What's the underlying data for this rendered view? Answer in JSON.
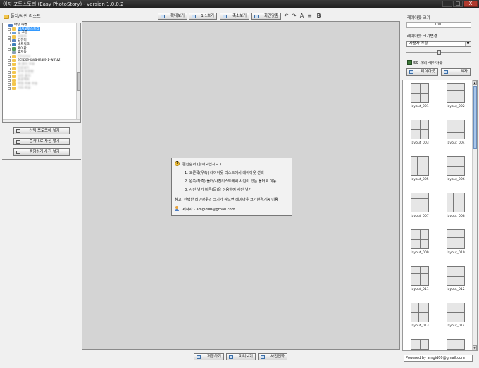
{
  "window": {
    "title": "이지 포토스토리 (Easy PhotoStory) - version 1.0.0.2",
    "buttons": [
      "_",
      "□",
      "X"
    ]
  },
  "left_panel": {
    "header": "폴더/사진 리스트",
    "tree": [
      {
        "label": "바탕 화면",
        "indent": 0,
        "icon": "desktop-icon",
        "expander": false
      },
      {
        "label": "이지포토스토리",
        "indent": 1,
        "icon": "folder-icon",
        "expander": true,
        "selected": true
      },
      {
        "label": "공 그룹",
        "indent": 1,
        "icon": "user-group-icon",
        "expander": true
      },
      {
        "label": "사용자",
        "indent": 1,
        "icon": "user-folder-icon",
        "expander": true,
        "blurred": true
      },
      {
        "label": "컴퓨터",
        "indent": 1,
        "icon": "computer-icon",
        "expander": true
      },
      {
        "label": "네트워크",
        "indent": 1,
        "icon": "network-icon",
        "expander": true
      },
      {
        "label": "제어판",
        "indent": 1,
        "icon": "control-panel-icon",
        "expander": true
      },
      {
        "label": "휴지통",
        "indent": 1,
        "icon": "recycle-bin-icon",
        "expander": false
      },
      {
        "label": "Chrome",
        "indent": 1,
        "icon": "folder-icon",
        "expander": true,
        "blurred": true
      },
      {
        "label": "eclipse-java-mars-1-win32",
        "indent": 1,
        "icon": "folder-icon",
        "expander": true
      },
      {
        "label": "새 폴더 모음",
        "indent": 1,
        "icon": "folder-icon",
        "expander": true,
        "blurred": true
      },
      {
        "label": "다운로드",
        "indent": 1,
        "icon": "folder-icon",
        "expander": true,
        "blurred": true
      },
      {
        "label": "문서 보관함",
        "indent": 1,
        "icon": "folder-icon",
        "expander": true,
        "blurred": true
      },
      {
        "label": "사진 폴더",
        "indent": 1,
        "icon": "folder-icon",
        "expander": true,
        "blurred": true
      },
      {
        "label": "프로젝트",
        "indent": 1,
        "icon": "folder-icon",
        "expander": true,
        "blurred": true
      },
      {
        "label": "작업 자료 모음",
        "indent": 1,
        "icon": "folder-icon",
        "expander": true,
        "blurred": true
      },
      {
        "label": "기타 파일",
        "indent": 1,
        "icon": "folder-icon",
        "expander": true,
        "blurred": true
      }
    ],
    "buttons": [
      {
        "label": "선택 포토모아 넣기",
        "icon": "insert-icon"
      },
      {
        "label": "순서대로 사진 넣기",
        "icon": "sequence-insert-icon"
      },
      {
        "label": "랜덤하게 사진 넣기",
        "icon": "random-insert-icon"
      }
    ]
  },
  "toolbar": {
    "buttons": [
      {
        "label": "확대보기",
        "icon": "zoom-in-icon"
      },
      {
        "label": "1:1보기",
        "icon": "actual-size-icon"
      },
      {
        "label": "축소보기",
        "icon": "zoom-out-icon"
      },
      {
        "label": "화면맞춤",
        "icon": "fit-screen-icon"
      }
    ],
    "icon_glyphs": [
      "↶",
      "↷",
      "A",
      "≡",
      "B"
    ]
  },
  "info_box": {
    "heading": "편집순서 (읽어보십시오.)",
    "steps": [
      "1. 오른쪽(우측) 레이아웃 리스트에서 레이아웃 선택",
      "2. 왼쪽(좌측) 폴더/사진리스트에서 사진이 있는 폴더로 이동",
      "3. 사진 넣기 버튼(들)을 이용하여 사진 넣기"
    ],
    "note": "참고. 선택한 레이아웃의 크기가 작으면 레이아웃 크기변경기능 이용",
    "author": "제작자 - amgid00@gmail.com"
  },
  "bottom_buttons": [
    {
      "label": "저장하기",
      "icon": "save-icon"
    },
    {
      "label": "미리보기",
      "icon": "preview-icon"
    },
    {
      "label": "사진인화",
      "icon": "print-icon"
    }
  ],
  "right_panel": {
    "size_label": "레이아웃 크기",
    "size_value": "0x0",
    "resize_label": "레이아웃 크기변경",
    "resize_select": "사용자 조정",
    "slider_level": 0.5,
    "count_text": "59 개의 레이아웃",
    "layout_button": "레이아웃",
    "frame_button": "액자",
    "layouts": [
      "layout_001",
      "layout_002",
      "layout_003",
      "layout_004",
      "layout_005",
      "layout_006",
      "layout_007",
      "layout_008",
      "layout_009",
      "layout_010",
      "layout_011",
      "layout_012",
      "layout_013",
      "layout_014",
      "layout_015",
      "layout_016"
    ],
    "credit": "Powered by amgid00@gmail.com"
  }
}
